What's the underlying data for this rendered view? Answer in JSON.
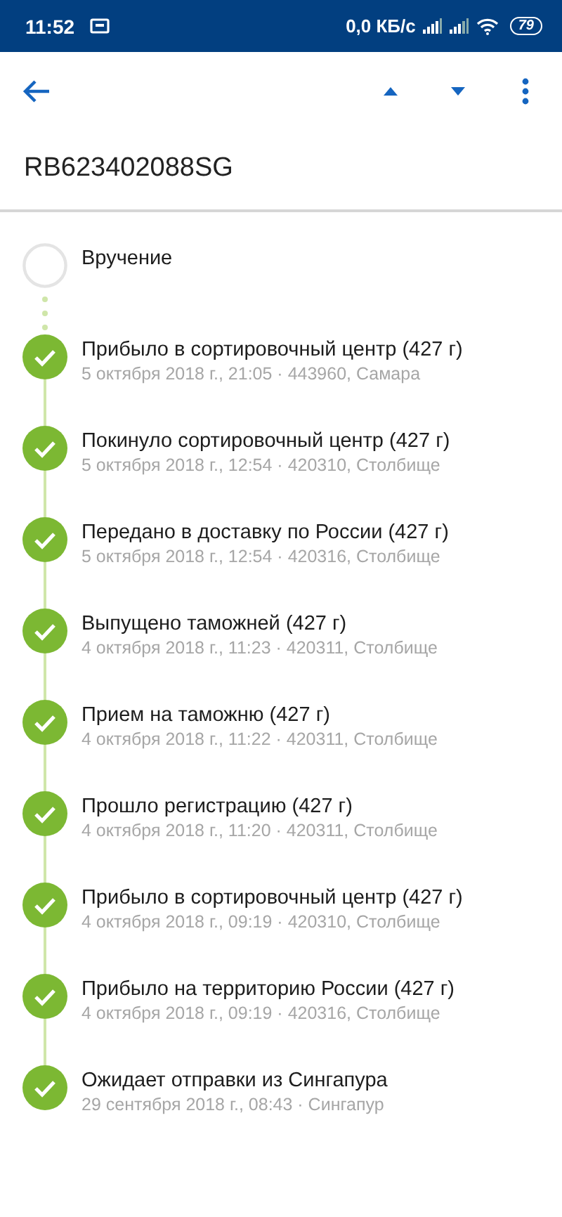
{
  "status_bar": {
    "time": "11:52",
    "speed": "0,0 КБ/с",
    "battery": "79"
  },
  "title": "RB623402088SG",
  "events": [
    {
      "title": "Вручение",
      "done": false
    },
    {
      "title": "Прибыло в сортировочный центр (427 г)",
      "details": "5 октября 2018 г., 21:05 · 443960, Самара",
      "done": true
    },
    {
      "title": "Покинуло сортировочный центр (427 г)",
      "details": "5 октября 2018 г., 12:54 · 420310, Столбище",
      "done": true
    },
    {
      "title": "Передано в доставку по России (427 г)",
      "details": "5 октября 2018 г., 12:54 · 420316, Столбище",
      "done": true
    },
    {
      "title": "Выпущено таможней (427 г)",
      "details": "4 октября 2018 г., 11:23 · 420311, Столбище",
      "done": true
    },
    {
      "title": "Прием на таможню (427 г)",
      "details": "4 октября 2018 г., 11:22 · 420311, Столбище",
      "done": true
    },
    {
      "title": "Прошло регистрацию (427 г)",
      "details": "4 октября 2018 г., 11:20 · 420311, Столбище",
      "done": true
    },
    {
      "title": "Прибыло в сортировочный центр (427 г)",
      "details": "4 октября 2018 г., 09:19 · 420310, Столбище",
      "done": true
    },
    {
      "title": "Прибыло на территорию России (427 г)",
      "details": "4 октября 2018 г., 09:19 · 420316, Столбище",
      "done": true
    },
    {
      "title": "Ожидает отправки из Сингапура",
      "details": "29 сентября 2018 г., 08:43 · Сингапур",
      "done": true
    }
  ]
}
